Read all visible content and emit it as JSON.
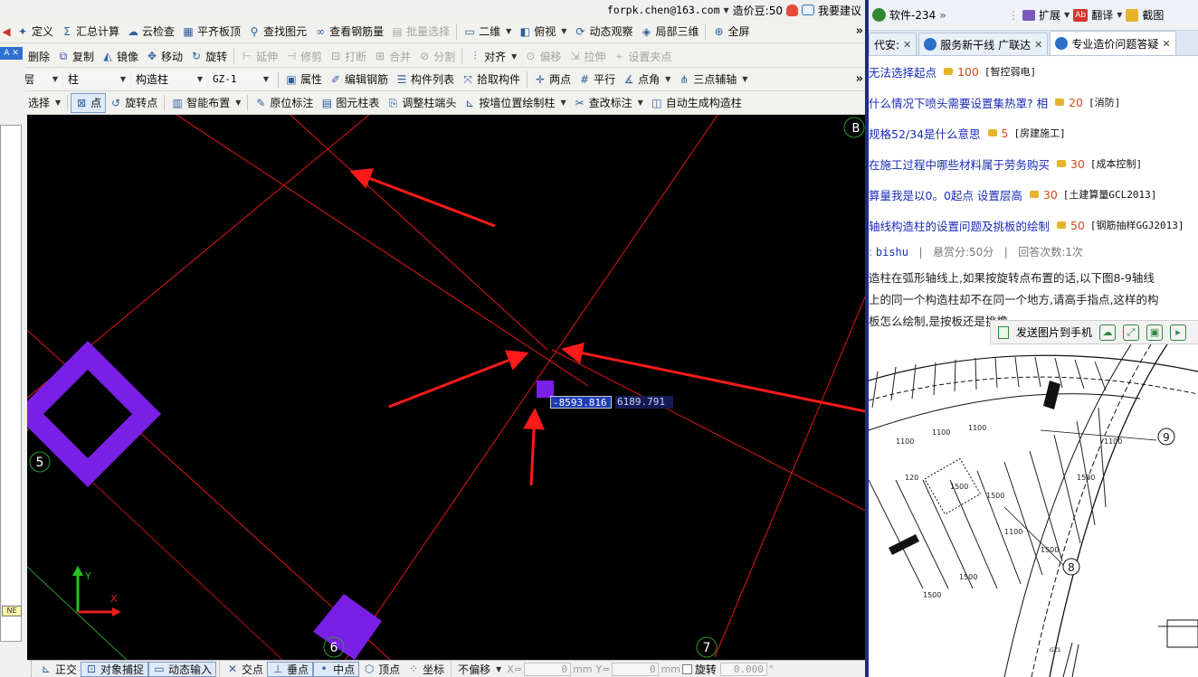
{
  "app": {
    "user_email": "forpk.chen@163.com",
    "balance": "造价豆:50",
    "suggest": "我要建议",
    "left_tab_label": "A",
    "left_ne_label": "NE",
    "toolbar1": [
      {
        "icon": "define-icon",
        "glyph": "✦",
        "label": "定义"
      },
      {
        "icon": "sigma-icon",
        "glyph": "Σ",
        "label": "汇总计算"
      },
      {
        "icon": "cloud-check-icon",
        "glyph": "☁",
        "label": "云检查"
      },
      {
        "icon": "flat-slab-icon",
        "glyph": "▦",
        "label": "平齐板顶"
      },
      {
        "icon": "binoculars-icon",
        "glyph": "⚲",
        "label": "查找图元"
      },
      {
        "icon": "rebar-view-icon",
        "glyph": "∞",
        "label": "查看钢筋量"
      },
      {
        "icon": "batch-select-icon",
        "glyph": "▤",
        "label": "批量选择",
        "disabled": true
      },
      {
        "icon": "2d-view-icon",
        "glyph": "▭",
        "label": "二维",
        "dropdown": true
      },
      {
        "icon": "top-view-icon",
        "glyph": "◧",
        "label": "俯视",
        "dropdown": true
      },
      {
        "icon": "dynamic-view-icon",
        "glyph": "⟳",
        "label": "动态观察"
      },
      {
        "icon": "local-3d-icon",
        "glyph": "◈",
        "label": "局部三维"
      },
      {
        "icon": "fullscreen-icon",
        "glyph": "⊕",
        "label": "全屏"
      }
    ],
    "toolbar2": [
      {
        "icon": "delete-icon",
        "glyph": "✎",
        "label": "删除"
      },
      {
        "icon": "copy-icon",
        "glyph": "⧉",
        "label": "复制"
      },
      {
        "icon": "mirror-icon",
        "glyph": "◭",
        "label": "镜像"
      },
      {
        "icon": "move-icon",
        "glyph": "✥",
        "label": "移动"
      },
      {
        "icon": "rotate-icon",
        "glyph": "↻",
        "label": "旋转"
      },
      {
        "icon": "extend-icon",
        "glyph": "⊢",
        "label": "延伸",
        "disabled": true
      },
      {
        "icon": "trim-icon",
        "glyph": "⊣",
        "label": "修剪",
        "disabled": true
      },
      {
        "icon": "break-icon",
        "glyph": "⊟",
        "label": "打断",
        "disabled": true
      },
      {
        "icon": "merge-icon",
        "glyph": "⊞",
        "label": "合并",
        "disabled": true
      },
      {
        "icon": "split-icon",
        "glyph": "⊘",
        "label": "分割",
        "disabled": true
      },
      {
        "icon": "align-icon",
        "glyph": "⫶",
        "label": "对齐",
        "dropdown": true
      },
      {
        "icon": "offset-icon",
        "glyph": "⊙",
        "label": "偏移",
        "disabled": true
      },
      {
        "icon": "stretch-icon",
        "glyph": "⇲",
        "label": "拉伸",
        "disabled": true
      },
      {
        "icon": "set-grip-icon",
        "glyph": "⌖",
        "label": "设置夹点",
        "disabled": true
      }
    ],
    "toolbar3_combos": [
      "首层",
      "柱",
      "构造柱",
      "GZ-1"
    ],
    "toolbar3": [
      {
        "icon": "properties-icon",
        "glyph": "▣",
        "label": "属性"
      },
      {
        "icon": "edit-rebar-icon",
        "glyph": "✐",
        "label": "编辑钢筋"
      },
      {
        "icon": "component-list-icon",
        "glyph": "☰",
        "label": "构件列表"
      },
      {
        "icon": "pick-component-icon",
        "glyph": "⤧",
        "label": "拾取构件"
      },
      {
        "icon": "two-point-icon",
        "glyph": "✛",
        "label": "两点"
      },
      {
        "icon": "parallel-icon",
        "glyph": "#",
        "label": "平行"
      },
      {
        "icon": "point-angle-icon",
        "glyph": "∡",
        "label": "点角",
        "dropdown": true
      },
      {
        "icon": "three-point-aux-icon",
        "glyph": "⋔",
        "label": "三点辅轴",
        "dropdown": true
      }
    ],
    "toolbar4": [
      {
        "icon": "select-cursor-icon",
        "glyph": "↖",
        "label": "选择",
        "dropdown": true
      },
      {
        "icon": "point-icon",
        "glyph": "⊠",
        "label": "点",
        "pressed": true
      },
      {
        "icon": "rotate-point-icon",
        "glyph": "↺",
        "label": "旋转点"
      },
      {
        "icon": "smart-layout-icon",
        "glyph": "▥",
        "label": "智能布置",
        "dropdown": true
      },
      {
        "icon": "in-place-label-icon",
        "glyph": "✎",
        "label": "原位标注"
      },
      {
        "icon": "column-table-icon",
        "glyph": "▤",
        "label": "图元柱表"
      },
      {
        "icon": "adjust-column-end-icon",
        "glyph": "⎘",
        "label": "调整柱端头"
      },
      {
        "icon": "draw-by-wall-icon",
        "glyph": "⊾",
        "label": "按墙位置绘制柱",
        "dropdown": true
      },
      {
        "icon": "modify-label-icon",
        "glyph": "✂",
        "label": "查改标注",
        "dropdown": true
      },
      {
        "icon": "auto-generate-icon",
        "glyph": "◫",
        "label": "自动生成构造柱"
      }
    ],
    "canvas": {
      "coord_x": "-8593.816",
      "coord_y": "6189.791",
      "axis_labels": [
        "5",
        "6",
        "7",
        "B"
      ],
      "ucs_y": "Y",
      "ucs_x": "X",
      "colors": {
        "background": "#000000",
        "grid_line": "#e01818",
        "column": "#7a1fe6",
        "arrow": "#ff1a1a",
        "axis_circle": "#2e9a2e"
      }
    },
    "statusbar": {
      "buttons": [
        {
          "icon": "ortho-icon",
          "glyph": "⊾",
          "label": "正交"
        },
        {
          "icon": "object-snap-icon",
          "glyph": "⊡",
          "label": "对象捕捉",
          "pressed": true
        },
        {
          "icon": "dynamic-input-icon",
          "glyph": "▭",
          "label": "动态输入",
          "pressed": true
        },
        {
          "icon": "intersection-icon",
          "glyph": "✕",
          "label": "交点"
        },
        {
          "icon": "perpendicular-icon",
          "glyph": "⊥",
          "label": "垂点",
          "pressed": true
        },
        {
          "icon": "midpoint-icon",
          "glyph": "•",
          "label": "中点",
          "pressed": true
        },
        {
          "icon": "vertex-icon",
          "glyph": "⬡",
          "label": "顶点"
        },
        {
          "icon": "coordinate-icon",
          "glyph": "⁘",
          "label": "坐标"
        }
      ],
      "offset_mode": "不偏移",
      "x_label": "X=",
      "x_value": "0",
      "y_label": "Y=",
      "y_value": "0",
      "unit": "mm",
      "rotate_label": "旋转",
      "rotate_value": "0.000",
      "degree": "°"
    }
  },
  "browser": {
    "toolbar": {
      "software": "软件-234",
      "extend": "扩展",
      "translate_badge": "Ab",
      "translate": "翻译",
      "screenshot": "截图"
    },
    "tabs": [
      {
        "label": "代安:",
        "active": false
      },
      {
        "label": "服务新干线 广联达",
        "active": false
      },
      {
        "label": "专业造价问题答疑",
        "active": true
      }
    ],
    "questions": [
      {
        "text": "无法选择起点",
        "points": "100",
        "category": "[智控弱电]"
      },
      {
        "text": "什么情况下喷头需要设置集热罩? 相",
        "points": "20",
        "category": "[消防]"
      },
      {
        "text": "规格52/34是什么意思",
        "points": "5",
        "category": "[房建施工]"
      },
      {
        "text": "在施工过程中哪些材料属于劳务购买",
        "points": "30",
        "category": "[成本控制]"
      },
      {
        "text": "算量我是以0。0起点 设置层高",
        "points": "30",
        "category": "[土建算量GCL2013]"
      },
      {
        "text": "轴线构造柱的设置问题及挑板的绘制",
        "points": "50",
        "category": "[钢筋抽样GGJ2013]"
      }
    ],
    "meta": {
      "user_prefix": ":",
      "user": "bishu",
      "sep": "|",
      "reward": "悬赏分:50分",
      "answers": "回答次数:1次"
    },
    "question_lines": [
      "造柱在弧形轴线上,如果按旋转点布置的话,以下图8-9轴线",
      "上的同一个构造柱却不在同一个地方,请高手指点,这样的构",
      "板怎么绘制,是按板还是挑檐"
    ],
    "image_toolbar": {
      "send": "发送图片到手机"
    },
    "drawing_labels": [
      "9",
      "8"
    ]
  }
}
